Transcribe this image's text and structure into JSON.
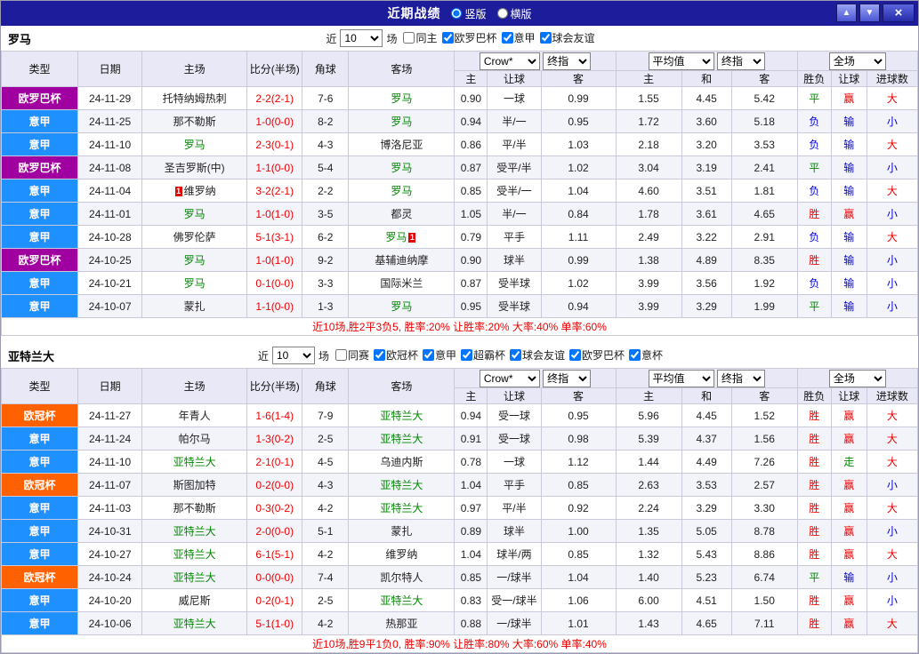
{
  "titlebar": {
    "title": "近期战绩",
    "vertical": "竖版",
    "horizontal": "横版",
    "up": "▲",
    "down": "▼",
    "close": "×"
  },
  "common": {
    "near": "近",
    "count": "10",
    "games": "场",
    "book": "Crow*",
    "final": "终指",
    "avg": "平均值",
    "scope": "全场",
    "cols": [
      "类型",
      "日期",
      "主场",
      "比分(半场)",
      "角球",
      "客场"
    ],
    "odds1": [
      "主",
      "让球",
      "客"
    ],
    "odds2": [
      "主",
      "和",
      "客"
    ],
    "results": [
      "胜负",
      "让球",
      "进球数"
    ]
  },
  "colors": {
    "titlebar_bg": "#1d1d9c",
    "serie_a_badge": "#1e90ff",
    "europa_badge": "#a000a0",
    "ucl_badge": "#ff6000",
    "team_highlight": "#008800",
    "win_red": "#ee0000",
    "draw_green": "#008800",
    "loss_blue": "#0000d8"
  },
  "sections": [
    {
      "team": "罗马",
      "filters": [
        {
          "label": "同主",
          "checked": false
        },
        {
          "label": "欧罗巴杯",
          "checked": true
        },
        {
          "label": "意甲",
          "checked": true
        },
        {
          "label": "球会友谊",
          "checked": true
        }
      ],
      "rows": [
        {
          "lg": "el",
          "type": "欧罗巴杯",
          "date": "24-11-29",
          "home": "托特纳姆热刺",
          "hg": 0,
          "score": "2-2(2-1)",
          "cn": "7-6",
          "away": "罗马",
          "ag": 1,
          "o1": "0.90",
          "hd": "一球",
          "o2": "0.99",
          "a1": "1.55",
          "a2": "4.45",
          "a3": "5.42",
          "res": [
            "平",
            "g"
          ],
          "let": [
            "赢",
            "r"
          ],
          "goal": [
            "大",
            "r"
          ]
        },
        {
          "lg": "sa",
          "type": "意甲",
          "date": "24-11-25",
          "home": "那不勒斯",
          "hg": 0,
          "score": "1-0(0-0)",
          "cn": "8-2",
          "away": "罗马",
          "ag": 1,
          "o1": "0.94",
          "hd": "半/一",
          "o2": "0.95",
          "a1": "1.72",
          "a2": "3.60",
          "a3": "5.18",
          "res": [
            "负",
            "b"
          ],
          "let": [
            "输",
            "b"
          ],
          "goal": [
            "小",
            "b"
          ]
        },
        {
          "lg": "sa",
          "type": "意甲",
          "date": "24-11-10",
          "home": "罗马",
          "hg": 1,
          "score": "2-3(0-1)",
          "cn": "4-3",
          "away": "博洛尼亚",
          "ag": 0,
          "o1": "0.86",
          "hd": "平/半",
          "o2": "1.03",
          "a1": "2.18",
          "a2": "3.20",
          "a3": "3.53",
          "res": [
            "负",
            "b"
          ],
          "let": [
            "输",
            "b"
          ],
          "goal": [
            "大",
            "r"
          ]
        },
        {
          "lg": "el",
          "type": "欧罗巴杯",
          "date": "24-11-08",
          "home": "圣吉罗斯(中)",
          "hg": 0,
          "score": "1-1(0-0)",
          "cn": "5-4",
          "away": "罗马",
          "ag": 1,
          "o1": "0.87",
          "hd": "受平/半",
          "o2": "1.02",
          "a1": "3.04",
          "a2": "3.19",
          "a3": "2.41",
          "res": [
            "平",
            "g"
          ],
          "let": [
            "输",
            "b"
          ],
          "goal": [
            "小",
            "b"
          ]
        },
        {
          "lg": "sa",
          "type": "意甲",
          "date": "24-11-04",
          "home": "维罗纳",
          "hg": 0,
          "hc": "1",
          "score": "3-2(2-1)",
          "cn": "2-2",
          "away": "罗马",
          "ag": 1,
          "o1": "0.85",
          "hd": "受半/一",
          "o2": "1.04",
          "a1": "4.60",
          "a2": "3.51",
          "a3": "1.81",
          "res": [
            "负",
            "b"
          ],
          "let": [
            "输",
            "b"
          ],
          "goal": [
            "大",
            "r"
          ]
        },
        {
          "lg": "sa",
          "type": "意甲",
          "date": "24-11-01",
          "home": "罗马",
          "hg": 1,
          "score": "1-0(1-0)",
          "cn": "3-5",
          "away": "都灵",
          "ag": 0,
          "o1": "1.05",
          "hd": "半/一",
          "o2": "0.84",
          "a1": "1.78",
          "a2": "3.61",
          "a3": "4.65",
          "res": [
            "胜",
            "r"
          ],
          "let": [
            "赢",
            "r"
          ],
          "goal": [
            "小",
            "b"
          ]
        },
        {
          "lg": "sa",
          "type": "意甲",
          "date": "24-10-28",
          "home": "佛罗伦萨",
          "hg": 0,
          "score": "5-1(3-1)",
          "cn": "6-2",
          "away": "罗马",
          "ag": 1,
          "ac": "1",
          "o1": "0.79",
          "hd": "平手",
          "o2": "1.11",
          "a1": "2.49",
          "a2": "3.22",
          "a3": "2.91",
          "res": [
            "负",
            "b"
          ],
          "let": [
            "输",
            "b"
          ],
          "goal": [
            "大",
            "r"
          ]
        },
        {
          "lg": "el",
          "type": "欧罗巴杯",
          "date": "24-10-25",
          "home": "罗马",
          "hg": 1,
          "score": "1-0(1-0)",
          "cn": "9-2",
          "away": "基辅迪纳摩",
          "ag": 0,
          "o1": "0.90",
          "hd": "球半",
          "o2": "0.99",
          "a1": "1.38",
          "a2": "4.89",
          "a3": "8.35",
          "res": [
            "胜",
            "r"
          ],
          "let": [
            "输",
            "b"
          ],
          "goal": [
            "小",
            "b"
          ]
        },
        {
          "lg": "sa",
          "type": "意甲",
          "date": "24-10-21",
          "home": "罗马",
          "hg": 1,
          "score": "0-1(0-0)",
          "cn": "3-3",
          "away": "国际米兰",
          "ag": 0,
          "o1": "0.87",
          "hd": "受半球",
          "o2": "1.02",
          "a1": "3.99",
          "a2": "3.56",
          "a3": "1.92",
          "res": [
            "负",
            "b"
          ],
          "let": [
            "输",
            "b"
          ],
          "goal": [
            "小",
            "b"
          ]
        },
        {
          "lg": "sa",
          "type": "意甲",
          "date": "24-10-07",
          "home": "蒙扎",
          "hg": 0,
          "score": "1-1(0-0)",
          "cn": "1-3",
          "away": "罗马",
          "ag": 1,
          "o1": "0.95",
          "hd": "受半球",
          "o2": "0.94",
          "a1": "3.99",
          "a2": "3.29",
          "a3": "1.99",
          "res": [
            "平",
            "g"
          ],
          "let": [
            "输",
            "b"
          ],
          "goal": [
            "小",
            "b"
          ]
        }
      ],
      "summary": "近10场,胜2平3负5, 胜率:20% 让胜率:20% 大率:40% 单率:60%"
    },
    {
      "team": "亚特兰大",
      "filters": [
        {
          "label": "同赛",
          "checked": false
        },
        {
          "label": "欧冠杯",
          "checked": true
        },
        {
          "label": "意甲",
          "checked": true
        },
        {
          "label": "超霸杯",
          "checked": true
        },
        {
          "label": "球会友谊",
          "checked": true
        },
        {
          "label": "欧罗巴杯",
          "checked": true
        },
        {
          "label": "意杯",
          "checked": true
        }
      ],
      "rows": [
        {
          "lg": "cl",
          "type": "欧冠杯",
          "date": "24-11-27",
          "home": "年青人",
          "hg": 0,
          "score": "1-6(1-4)",
          "cn": "7-9",
          "away": "亚特兰大",
          "ag": 1,
          "o1": "0.94",
          "hd": "受一球",
          "o2": "0.95",
          "a1": "5.96",
          "a2": "4.45",
          "a3": "1.52",
          "res": [
            "胜",
            "r"
          ],
          "let": [
            "赢",
            "r"
          ],
          "goal": [
            "大",
            "r"
          ]
        },
        {
          "lg": "sa",
          "type": "意甲",
          "date": "24-11-24",
          "home": "帕尔马",
          "hg": 0,
          "score": "1-3(0-2)",
          "cn": "2-5",
          "away": "亚特兰大",
          "ag": 1,
          "o1": "0.91",
          "hd": "受一球",
          "o2": "0.98",
          "a1": "5.39",
          "a2": "4.37",
          "a3": "1.56",
          "res": [
            "胜",
            "r"
          ],
          "let": [
            "赢",
            "r"
          ],
          "goal": [
            "大",
            "r"
          ]
        },
        {
          "lg": "sa",
          "type": "意甲",
          "date": "24-11-10",
          "home": "亚特兰大",
          "hg": 1,
          "score": "2-1(0-1)",
          "cn": "4-5",
          "away": "乌迪内斯",
          "ag": 0,
          "o1": "0.78",
          "hd": "一球",
          "o2": "1.12",
          "a1": "1.44",
          "a2": "4.49",
          "a3": "7.26",
          "res": [
            "胜",
            "r"
          ],
          "let": [
            "走",
            "g"
          ],
          "goal": [
            "大",
            "r"
          ]
        },
        {
          "lg": "cl",
          "type": "欧冠杯",
          "date": "24-11-07",
          "home": "斯图加特",
          "hg": 0,
          "score": "0-2(0-0)",
          "cn": "4-3",
          "away": "亚特兰大",
          "ag": 1,
          "o1": "1.04",
          "hd": "平手",
          "o2": "0.85",
          "a1": "2.63",
          "a2": "3.53",
          "a3": "2.57",
          "res": [
            "胜",
            "r"
          ],
          "let": [
            "赢",
            "r"
          ],
          "goal": [
            "小",
            "b"
          ]
        },
        {
          "lg": "sa",
          "type": "意甲",
          "date": "24-11-03",
          "home": "那不勒斯",
          "hg": 0,
          "score": "0-3(0-2)",
          "cn": "4-2",
          "away": "亚特兰大",
          "ag": 1,
          "o1": "0.97",
          "hd": "平/半",
          "o2": "0.92",
          "a1": "2.24",
          "a2": "3.29",
          "a3": "3.30",
          "res": [
            "胜",
            "r"
          ],
          "let": [
            "赢",
            "r"
          ],
          "goal": [
            "大",
            "r"
          ]
        },
        {
          "lg": "sa",
          "type": "意甲",
          "date": "24-10-31",
          "home": "亚特兰大",
          "hg": 1,
          "score": "2-0(0-0)",
          "cn": "5-1",
          "away": "蒙扎",
          "ag": 0,
          "o1": "0.89",
          "hd": "球半",
          "o2": "1.00",
          "a1": "1.35",
          "a2": "5.05",
          "a3": "8.78",
          "res": [
            "胜",
            "r"
          ],
          "let": [
            "赢",
            "r"
          ],
          "goal": [
            "小",
            "b"
          ]
        },
        {
          "lg": "sa",
          "type": "意甲",
          "date": "24-10-27",
          "home": "亚特兰大",
          "hg": 1,
          "score": "6-1(5-1)",
          "cn": "4-2",
          "away": "维罗纳",
          "ag": 0,
          "o1": "1.04",
          "hd": "球半/两",
          "o2": "0.85",
          "a1": "1.32",
          "a2": "5.43",
          "a3": "8.86",
          "res": [
            "胜",
            "r"
          ],
          "let": [
            "赢",
            "r"
          ],
          "goal": [
            "大",
            "r"
          ]
        },
        {
          "lg": "cl",
          "type": "欧冠杯",
          "date": "24-10-24",
          "home": "亚特兰大",
          "hg": 1,
          "score": "0-0(0-0)",
          "cn": "7-4",
          "away": "凯尔特人",
          "ag": 0,
          "o1": "0.85",
          "hd": "一/球半",
          "o2": "1.04",
          "a1": "1.40",
          "a2": "5.23",
          "a3": "6.74",
          "res": [
            "平",
            "g"
          ],
          "let": [
            "输",
            "b"
          ],
          "goal": [
            "小",
            "b"
          ]
        },
        {
          "lg": "sa",
          "type": "意甲",
          "date": "24-10-20",
          "home": "威尼斯",
          "hg": 0,
          "score": "0-2(0-1)",
          "cn": "2-5",
          "away": "亚特兰大",
          "ag": 1,
          "o1": "0.83",
          "hd": "受一/球半",
          "o2": "1.06",
          "a1": "6.00",
          "a2": "4.51",
          "a3": "1.50",
          "res": [
            "胜",
            "r"
          ],
          "let": [
            "赢",
            "r"
          ],
          "goal": [
            "小",
            "b"
          ]
        },
        {
          "lg": "sa",
          "type": "意甲",
          "date": "24-10-06",
          "home": "亚特兰大",
          "hg": 1,
          "score": "5-1(1-0)",
          "cn": "4-2",
          "away": "热那亚",
          "ag": 0,
          "o1": "0.88",
          "hd": "一/球半",
          "o2": "1.01",
          "a1": "1.43",
          "a2": "4.65",
          "a3": "7.11",
          "res": [
            "胜",
            "r"
          ],
          "let": [
            "赢",
            "r"
          ],
          "goal": [
            "大",
            "r"
          ]
        }
      ],
      "summary": "近10场,胜9平1负0, 胜率:90% 让胜率:80% 大率:60% 单率:40%"
    }
  ]
}
